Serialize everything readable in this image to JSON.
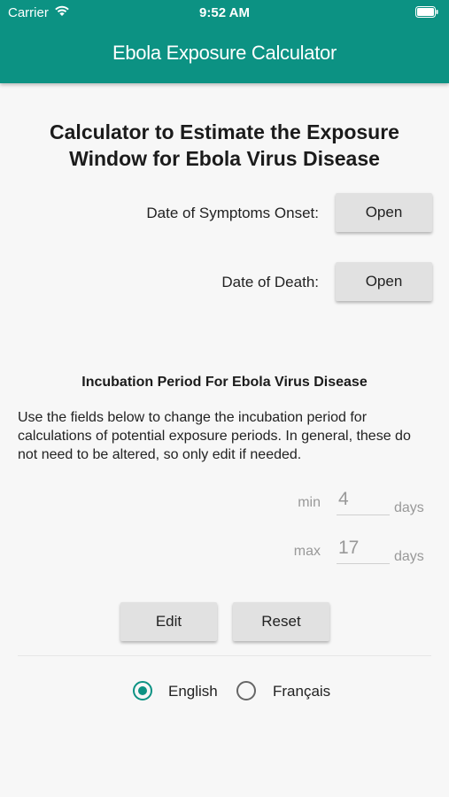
{
  "status_bar": {
    "carrier": "Carrier",
    "time": "9:52 AM"
  },
  "header": {
    "title": "Ebola Exposure Calculator",
    "color": "#0c9283"
  },
  "main": {
    "title_line1": "Calculator to Estimate the Exposure",
    "title_line2": "Window for Ebola Virus Disease",
    "symptoms_onset": {
      "label": "Date of Symptoms Onset:",
      "button": "Open"
    },
    "death": {
      "label": "Date of Death:",
      "button": "Open"
    }
  },
  "incubation": {
    "title": "Incubation Period For Ebola Virus Disease",
    "description": "Use the fields below to change the incubation period for calculations of potential exposure periods. In general, these do not need to be altered, so only edit if needed.",
    "min": {
      "label": "min",
      "value": "4",
      "unit": "days"
    },
    "max": {
      "label": "max",
      "value": "17",
      "unit": "days"
    },
    "edit_button": "Edit",
    "reset_button": "Reset"
  },
  "language": {
    "selected": "English",
    "options": [
      "English",
      "Français"
    ]
  }
}
